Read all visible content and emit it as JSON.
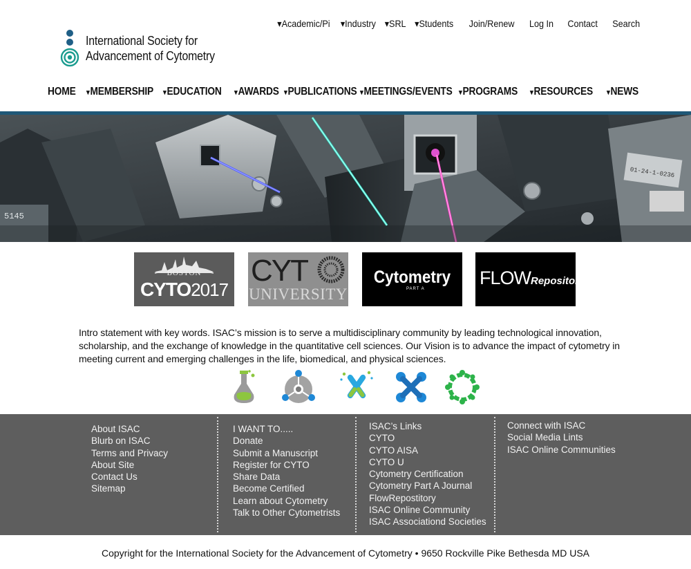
{
  "org": {
    "name_line1": "International Society for",
    "name_line2": "Advancement of Cytometry"
  },
  "top_nav": [
    {
      "label": "▾Academic/Pi",
      "caret": true
    },
    {
      "label": "▾Industry",
      "caret": true
    },
    {
      "label": "▾SRL",
      "caret": true
    },
    {
      "label": "▾Students",
      "caret": true
    },
    {
      "label": "Join/Renew",
      "caret": false
    },
    {
      "label": "Log In",
      "caret": false
    },
    {
      "label": "Contact",
      "caret": false
    },
    {
      "label": "Search",
      "caret": false
    }
  ],
  "main_nav": [
    {
      "label": "HOME",
      "caret": ""
    },
    {
      "label": "MEMBERSHIP",
      "caret": "▾"
    },
    {
      "label": "EDUCATION",
      "caret": "▾"
    },
    {
      "label": "AWARDS",
      "caret": "▾"
    },
    {
      "label": "PUBLICATIONS",
      "caret": "▾"
    },
    {
      "label": "MEETINGS/EVENTS",
      "caret": "▾"
    },
    {
      "label": "PROGRAMS",
      "caret": "▾"
    },
    {
      "label": "RESOURCES",
      "caret": "▾"
    },
    {
      "label": "NEWS",
      "caret": "▾"
    }
  ],
  "brands": {
    "cyto2017": {
      "top": "BOSTON",
      "main": "CYTO",
      "year": "2017"
    },
    "cytou": {
      "top": "CYT",
      "bottom": "UNIVERSITY"
    },
    "cytometry": {
      "main": "Cytometry",
      "sub": "PART A"
    },
    "flowrepo": {
      "flow": "FLOW",
      "repo": "Repository"
    }
  },
  "intro_text": "Intro statement with key words. ISAC’s mission is to serve a multidisciplinary community by leading technological innova­tion, scholarship, and the exchange of knowledge in the quantitative cell sciences. Our Vision is to advance the impact of cy­tometry in meeting current and emerging challenges in the life, biomedical, and physical sciences.",
  "feature_icons": [
    "flask-icon",
    "network-icon",
    "test-tubes-icon",
    "people-link-icon",
    "community-ring-icon"
  ],
  "colors": {
    "accent_bar": "#1f5877",
    "footer_bg": "#5e5e5e",
    "logo_teal": "#1a9c8f",
    "logo_blue": "#1f5f86"
  },
  "footer": {
    "col1": [
      "About ISAC",
      "Blurb on ISAC",
      "Terms and Privacy",
      "About Site",
      "Contact Us",
      "Sitemap"
    ],
    "col2": [
      "I WANT TO.....",
      "Donate",
      "Submit a Manuscript",
      "Register for CYTO",
      "Share Data",
      "Become Certified",
      "Learn about Cytometry",
      "Talk to Other Cytometrists"
    ],
    "col3": [
      "ISAC’s Links",
      "CYTO",
      "CYTO AISA",
      "CYTO U",
      "Cytometry Certification",
      "Cytometry Part A Journal",
      "FlowRepostitory",
      "ISAC Online Community",
      "ISAC Associationd Societies"
    ],
    "col4": [
      "Connect with  ISAC",
      "Social Media Lints",
      "ISAC Online Communities"
    ]
  },
  "copyright": "Copyright for the International Society for the Advancement of Cytometry • 9650 Rockville Pike Bethesda MD USA"
}
